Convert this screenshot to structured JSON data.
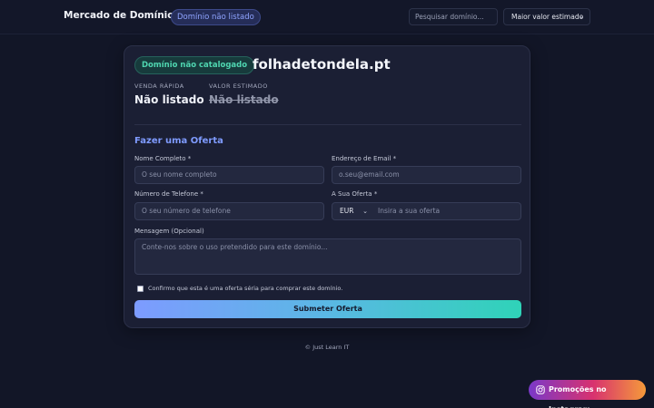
{
  "header": {
    "brand": "Mercado de Domínios",
    "brand_pill": "Domínio não listado",
    "search_placeholder": "Pesquisar domínio...",
    "sort_selected": "Maior valor estimado"
  },
  "domain": {
    "status": "Domínio não catalogado",
    "name": "folhadetondela.pt",
    "quick_sale_label": "VENDA RÁPIDA",
    "quick_sale_value": "Não listado",
    "estimated_label": "VALOR ESTIMADO",
    "estimated_value": "Não listado"
  },
  "form": {
    "title": "Fazer uma Oferta",
    "name_label": "Nome Completo *",
    "name_placeholder": "O seu nome completo",
    "email_label": "Endereço de Email *",
    "email_placeholder": "o.seu@email.com",
    "phone_label": "Número de Telefone *",
    "phone_placeholder": "O seu número de telefone",
    "offer_label": "A Sua Oferta *",
    "currency": "EUR",
    "offer_placeholder": "Insira a sua oferta",
    "message_label": "Mensagem (Opcional)",
    "message_placeholder": "Conte-nos sobre o uso pretendido para este domínio...",
    "confirm_label": "Confirmo que esta é uma oferta séria para comprar este domínio.",
    "submit_label": "Submeter Oferta"
  },
  "footer": {
    "copyright": "© Just Learn IT"
  },
  "promo": {
    "label": "Promoções no Instagram",
    "icon": "instagram-icon"
  },
  "colors": {
    "background": "#121627",
    "accent": "#7f9bff",
    "success": "#4fd6b0"
  }
}
